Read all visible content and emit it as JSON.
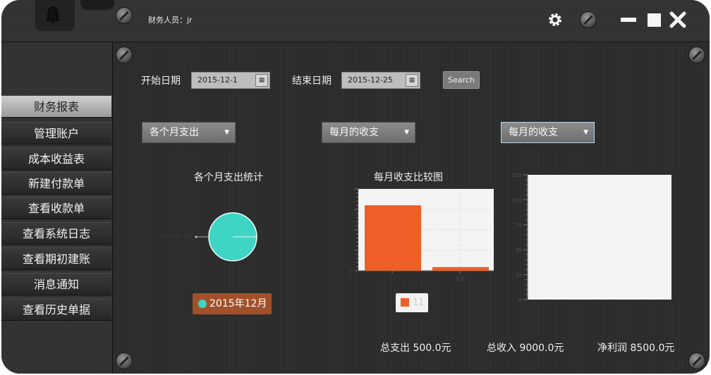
{
  "header": {
    "user_label": "财务人员：jr",
    "icons": [
      "bell-icon",
      "gear-icon",
      "minimize-icon",
      "maximize-icon",
      "close-icon"
    ]
  },
  "sidebar": {
    "items": [
      {
        "label": "财务报表",
        "active": true
      },
      {
        "label": "管理账户",
        "active": false
      },
      {
        "label": "成本收益表",
        "active": false
      },
      {
        "label": "新建付款单",
        "active": false
      },
      {
        "label": "查看收款单",
        "active": false
      },
      {
        "label": "查看系统日志",
        "active": false
      },
      {
        "label": "查看期初建账",
        "active": false
      },
      {
        "label": "消息通知",
        "active": false
      },
      {
        "label": "查看历史单据",
        "active": false
      }
    ]
  },
  "filters": {
    "start_label": "开始日期",
    "start_value": "2015-12-1",
    "end_label": "结束日期",
    "end_value": "2015-12-25",
    "search_label": "Search"
  },
  "dropdowns": [
    {
      "value": "各个月支出"
    },
    {
      "value": "每月的收支"
    },
    {
      "value": "每月的收支"
    }
  ],
  "chart_data": [
    {
      "type": "pie",
      "title": "各个月支出统计",
      "slices": [
        {
          "label": "2015年12月",
          "value": 500.0
        }
      ],
      "legend": [
        "2015年12月"
      ],
      "slice_label": "2015年12月"
    },
    {
      "type": "bar",
      "title": "每月收支比较图",
      "categories": [
        "收入",
        "支出"
      ],
      "series": [
        {
          "name": "11",
          "values": [
            9000.0,
            500.0
          ]
        }
      ],
      "visible_tick_labels": [
        "0",
        "支出"
      ]
    },
    {
      "type": "line",
      "title": "",
      "ylim": [
        0,
        125
      ],
      "yticks": [
        0,
        25,
        50,
        75,
        100,
        125
      ],
      "series": []
    }
  ],
  "summary": {
    "expense": "总支出  500.0元",
    "income": "总收入  9000.0元",
    "profit": "净利润  8500.0元"
  }
}
